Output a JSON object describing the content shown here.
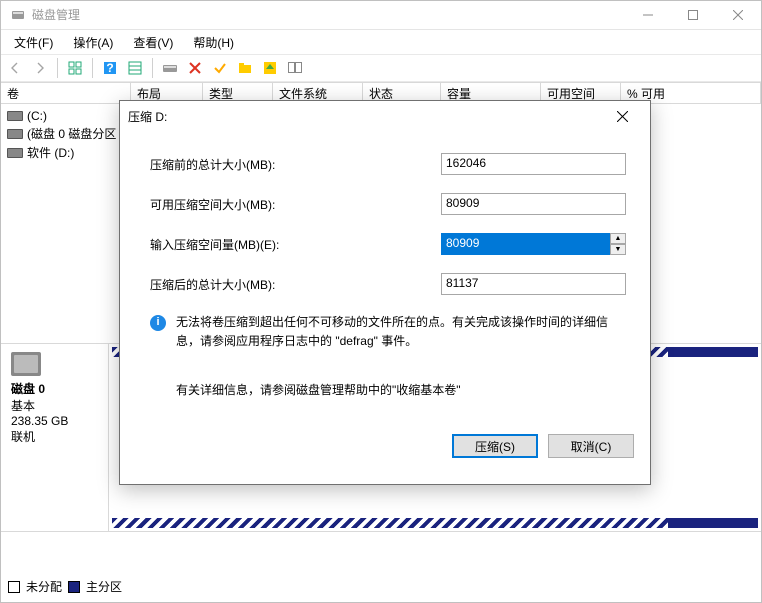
{
  "window": {
    "title": "磁盘管理",
    "menus": {
      "file": "文件(F)",
      "action": "操作(A)",
      "view": "查看(V)",
      "help": "帮助(H)"
    },
    "columns": {
      "vol": "卷",
      "layout": "布局",
      "type": "类型",
      "fs": "文件系统",
      "status": "状态",
      "capacity": "容量",
      "free": "可用空间",
      "pct": "% 可用"
    },
    "volumes": [
      {
        "label": "(C:)"
      },
      {
        "label": "(磁盘 0 磁盘分区"
      },
      {
        "label": "软件 (D:)"
      }
    ],
    "disk_panel": {
      "disk_label": "磁盘 0",
      "type": "基本",
      "size": "238.35 GB",
      "status": "联机"
    },
    "legend": {
      "unalloc": "未分配",
      "primary": "主分区"
    }
  },
  "dialog": {
    "title": "压缩 D:",
    "rows": {
      "total_before": {
        "label": "压缩前的总计大小(MB):",
        "value": "162046"
      },
      "avail": {
        "label": "可用压缩空间大小(MB):",
        "value": "80909"
      },
      "input": {
        "label": "输入压缩空间量(MB)(E):",
        "value": "80909"
      },
      "total_after": {
        "label": "压缩后的总计大小(MB):",
        "value": "81137"
      }
    },
    "info_line": "无法将卷压缩到超出任何不可移动的文件所在的点。有关完成该操作时间的详细信息，请参阅应用程序日志中的 \"defrag\" 事件。",
    "help_line": "有关详细信息，请参阅磁盘管理帮助中的\"收缩基本卷\"",
    "buttons": {
      "shrink": "压缩(S)",
      "cancel": "取消(C)"
    }
  }
}
